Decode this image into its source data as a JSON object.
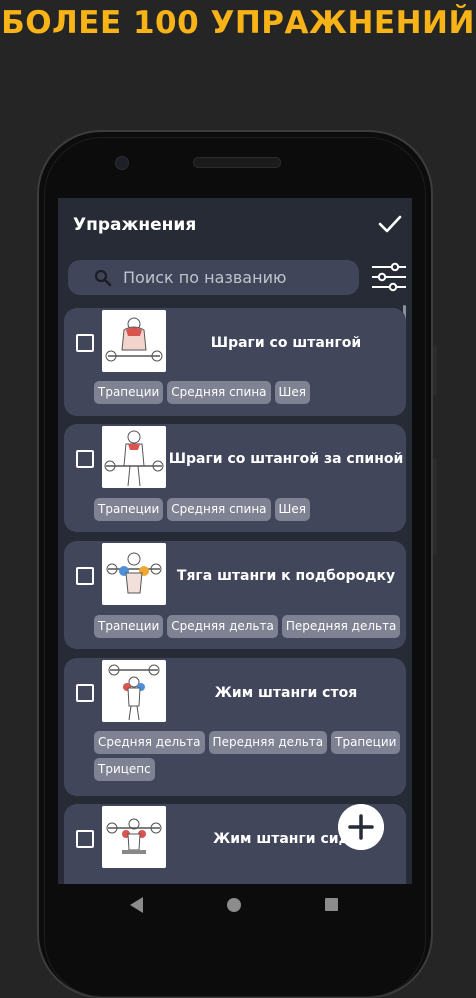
{
  "banner": "БОЛЕЕ 100 УПРАЖНЕНИЙ",
  "header": {
    "title": "Упражнения"
  },
  "search": {
    "placeholder": "Поиск по названию"
  },
  "exercises": [
    {
      "name": "Шраги со штангой",
      "tags": [
        "Трапеции",
        "Средняя спина",
        "Шея"
      ]
    },
    {
      "name": "Шраги со штангой за спиной",
      "tags": [
        "Трапеции",
        "Средняя спина",
        "Шея"
      ]
    },
    {
      "name": "Тяга штанги к подбородку",
      "tags": [
        "Трапеции",
        "Средняя дельта",
        "Передняя дельта"
      ]
    },
    {
      "name": "Жим штанги стоя",
      "tags": [
        "Средняя дельта",
        "Передняя дельта",
        "Трапеции",
        "Трицепс"
      ]
    },
    {
      "name": "Жим штанги сидя",
      "tags": []
    }
  ],
  "colors": {
    "banner": "#f8b317",
    "screen_bg": "#272b36",
    "card_bg": "#41465a",
    "tag_bg": "#7e8292",
    "search_bg": "#40455a"
  },
  "icons": {
    "confirm": "check-icon",
    "search": "search-icon",
    "filter": "sliders-icon",
    "add": "plus-icon",
    "checkbox": "checkbox-icon"
  }
}
